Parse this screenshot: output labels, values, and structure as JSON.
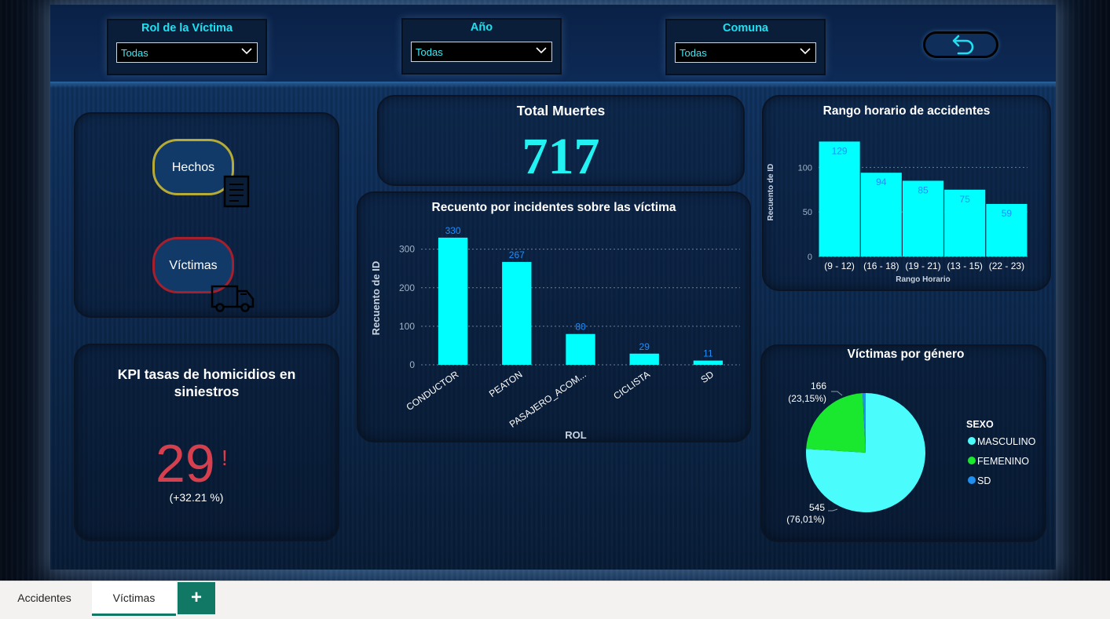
{
  "filters": {
    "rol": {
      "label": "Rol de la Víctima",
      "value": "Todas"
    },
    "anio": {
      "label": "Año",
      "value": "Todas"
    },
    "comuna": {
      "label": "Comuna",
      "value": "Todas"
    }
  },
  "nav": {
    "hechos_label": "Hechos",
    "victimas_label": "Víctimas"
  },
  "back_icon": "undo-arrow-icon",
  "kpi": {
    "title": "KPI tasas de homicidios en siniestros",
    "value": "29",
    "alert": "!",
    "change": "(+32.21 %)",
    "color": "#d6404e"
  },
  "total": {
    "title": "Total Muertes",
    "value": "717",
    "color": "#22f2f2"
  },
  "colors": {
    "cyan": "#00ffff",
    "pie_cyan": "#4bfcfc",
    "green": "#19e82f",
    "blue": "#1f8ff0",
    "label_blue": "#1c8fff"
  },
  "chart_data": [
    {
      "type": "bar",
      "title": "Recuento por incidentes sobre las víctima",
      "xlabel": "ROL",
      "ylabel": "Recuento de ID",
      "categories": [
        "CONDUCTOR",
        "PEATON",
        "PASAJERO_ACOM...",
        "CICLISTA",
        "SD"
      ],
      "values": [
        330,
        267,
        80,
        29,
        11
      ],
      "ylim": [
        0,
        340
      ],
      "yticks": [
        0,
        100,
        200,
        300
      ],
      "grid": true
    },
    {
      "type": "bar",
      "title": "Rango horario de accidentes",
      "xlabel": "Rango Horario",
      "ylabel": "Recuento de ID",
      "categories": [
        "(9 - 12)",
        "(16 - 18)",
        "(19 - 21)",
        "(13 - 15)",
        "(22 - 23)"
      ],
      "values": [
        129,
        94,
        85,
        75,
        59
      ],
      "ylim": [
        0,
        132
      ],
      "yticks": [
        0,
        50,
        100
      ],
      "grid": true
    },
    {
      "type": "pie",
      "title": "Víctimas por género",
      "legend_title": "SEXO",
      "legend_position": "right",
      "slices": [
        {
          "name": "MASCULINO",
          "value": 545,
          "label_value": "545",
          "label_pct": "(76,01%)",
          "color": "#4bfcfc"
        },
        {
          "name": "FEMENINO",
          "value": 166,
          "label_value": "166",
          "label_pct": "(23,15%)",
          "color": "#19e82f"
        },
        {
          "name": "SD",
          "value": 6,
          "label_value": "",
          "label_pct": "",
          "color": "#1f8ff0"
        }
      ]
    }
  ],
  "tabs": {
    "items": [
      {
        "label": "Accidentes"
      },
      {
        "label": "Víctimas"
      }
    ],
    "add_label": "+"
  }
}
